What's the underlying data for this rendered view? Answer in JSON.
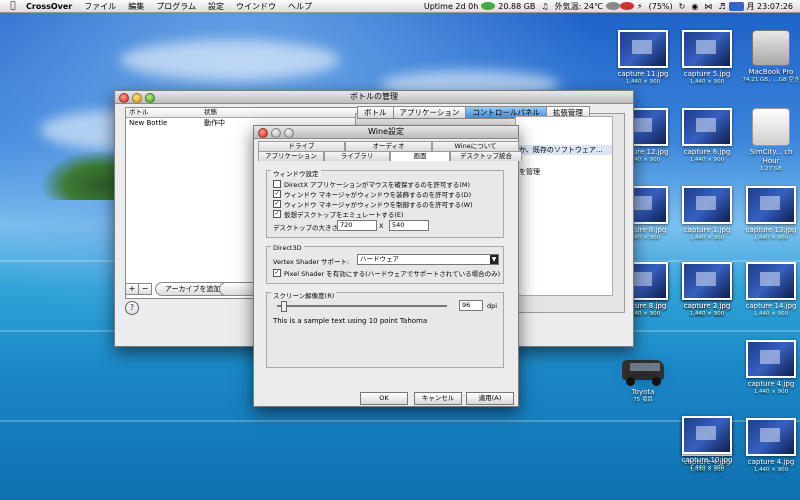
{
  "menubar": {
    "app": "CrossOver",
    "items": [
      "ファイル",
      "編集",
      "プログラム",
      "設定",
      "ウインドウ",
      "ヘルプ"
    ],
    "status": {
      "uptime": "Uptime 2d 0h",
      "disk": "20.88 GB",
      "temp": "外気温: 24℃",
      "battery": "(75%)",
      "clock": "月 23:07:26"
    }
  },
  "desktop_icons": [
    {
      "name": "capture 11.jpg",
      "size": "1,440 × 900",
      "kind": "thumb"
    },
    {
      "name": "capture 5.jpg",
      "size": "1,440 × 900",
      "kind": "thumb"
    },
    {
      "name": "MacBook Pro",
      "size": "74.21 GB，...GB 空き",
      "kind": "hdd"
    },
    {
      "name": "capture 12.jpg",
      "size": "1,440 × 900",
      "kind": "thumb"
    },
    {
      "name": "capture 6.jpg",
      "size": "1,440 × 900",
      "kind": "thumb"
    },
    {
      "name": "SimCity... ch Hour",
      "size": "1.27 GB",
      "kind": "drive"
    },
    {
      "name": "capture 8.jpg",
      "size": "1,440 × 900",
      "kind": "thumb"
    },
    {
      "name": "capture 1.jpg",
      "size": "1,440 × 900",
      "kind": "thumb"
    },
    {
      "name": "capture 13.jpg",
      "size": "1,440 × 900",
      "kind": "thumb"
    },
    {
      "name": "capture 7.jpg",
      "size": "1,440 × 900",
      "kind": "thumb"
    },
    {
      "name": "capture 2.jpg",
      "size": "1,440 × 900",
      "kind": "thumb"
    },
    {
      "name": "capture 14.jpg",
      "size": "1,440 × 900",
      "kind": "thumb"
    },
    {
      "name": "capture 8.jpg",
      "size": "1,440 × 900",
      "kind": "thumb"
    },
    {
      "name": "capture 3.jpg",
      "size": "1,440 × 900",
      "kind": "thumb"
    },
    {
      "name": "Toyota",
      "size": "75 項目",
      "kind": "van"
    },
    {
      "name": "capture 4.jpg",
      "size": "1,440 × 900",
      "kind": "thumb"
    },
    {
      "name": "capture 4.jpg",
      "size": "1,440 × 900",
      "kind": "thumb"
    },
    {
      "name": "capture 10.jpg",
      "size": "1,440 × 900",
      "kind": "thumb"
    },
    {
      "name": "capture 4.jpg",
      "size": "1,440 × 900",
      "kind": "thumb"
    }
  ],
  "bottle_manager": {
    "title": "ボトルの管理",
    "columns": [
      "ボトル",
      "状態"
    ],
    "rows": [
      {
        "bottle": "New Bottle",
        "status": "動作中"
      }
    ],
    "tabs": [
      "ボトル",
      "アプリケーション",
      "コントロールパネル",
      "拡張管理"
    ],
    "selected_tab": "コントロールパネル",
    "panel_items": [
      "か、既存のソフトウェア…",
      "を管理"
    ],
    "add_button": "+",
    "remove_button": "−",
    "archive_button": "アーカイブを追加...",
    "help": "?"
  },
  "wine_config": {
    "title": "Wine設定",
    "tabs_row1": [
      "ドライブ",
      "オーディオ",
      "Wineについて"
    ],
    "tabs_row2": [
      "アプリケーション",
      "ライブラリ",
      "画面",
      "デスクトップ統合"
    ],
    "selected_tab": "画面",
    "window_group": {
      "title": "ウィンドウ設定",
      "options": [
        {
          "label": "DirectX アプリケーションがマウスを確保するのを許可する(M)",
          "checked": false
        },
        {
          "label": "ウィンドウ マネージャがウィンドウを装飾するのを許可する(D)",
          "checked": true
        },
        {
          "label": "ウィンドウ マネージャがウィンドウを制御するのを許可する(W)",
          "checked": true
        },
        {
          "label": "仮想デスクトップをエミュレートする(E)",
          "checked": true
        }
      ],
      "desktop_size_label": "デスクトップの大きさ:",
      "width": "720",
      "x": "X",
      "height": "540"
    },
    "d3d_group": {
      "title": "Direct3D",
      "vertex_label": "Vertex Shader サポート:",
      "vertex_value": "ハードウェア",
      "pixel_shader": {
        "label": "Pixel Shader を有効にする(ハードウェアでサポートされている場合のみ)",
        "checked": true
      }
    },
    "dpi_group": {
      "title": "スクリーン解像度(R)",
      "value": "96",
      "unit": "dpi",
      "sample": "This is a sample text using 10 point Tahoma"
    },
    "buttons": {
      "ok": "OK",
      "cancel": "キャンセル",
      "apply": "適用(A)"
    }
  }
}
